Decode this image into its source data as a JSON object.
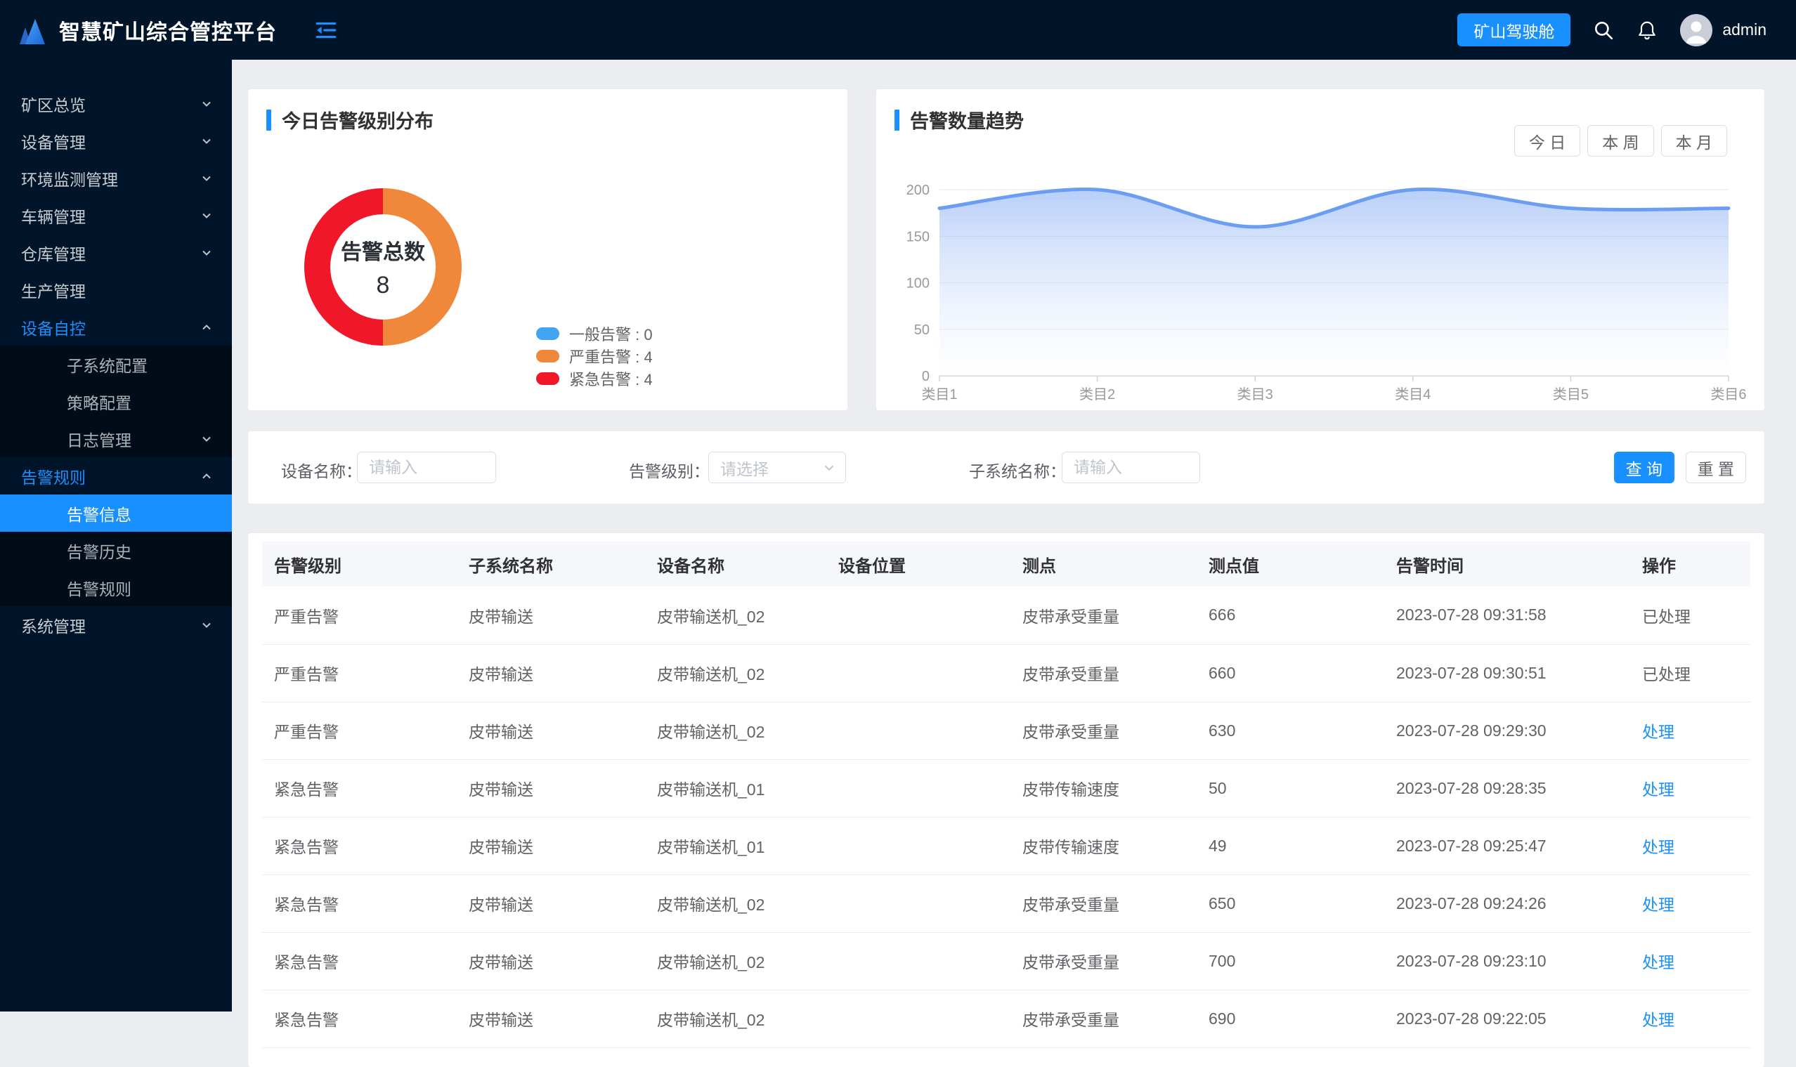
{
  "header": {
    "app_title": "智慧矿山综合管控平台",
    "cockpit_button": "矿山驾驶舱",
    "username": "admin"
  },
  "sidebar": {
    "items": [
      {
        "key": "mine-overview",
        "label": "矿区总览",
        "arrow": "down"
      },
      {
        "key": "device-management",
        "label": "设备管理",
        "arrow": "down"
      },
      {
        "key": "env-monitor-management",
        "label": "环境监测管理",
        "arrow": "down"
      },
      {
        "key": "vehicle-management",
        "label": "车辆管理",
        "arrow": "down"
      },
      {
        "key": "warehouse-management",
        "label": "仓库管理",
        "arrow": "down"
      },
      {
        "key": "production-management",
        "label": "生产管理",
        "arrow": "none"
      },
      {
        "key": "device-autocontrol",
        "label": "设备自控",
        "arrow": "up",
        "expanded": true,
        "children": [
          {
            "key": "subsystem-config",
            "label": "子系统配置",
            "arrow": "none"
          },
          {
            "key": "strategy-config",
            "label": "策略配置",
            "arrow": "none"
          },
          {
            "key": "log-management",
            "label": "日志管理",
            "arrow": "down"
          }
        ]
      },
      {
        "key": "alarm-rules-group",
        "label": "告警规则",
        "arrow": "up",
        "expanded": true,
        "children": [
          {
            "key": "alarm-info",
            "label": "告警信息",
            "arrow": "none",
            "active": true
          },
          {
            "key": "alarm-history",
            "label": "告警历史",
            "arrow": "none"
          },
          {
            "key": "alarm-rules",
            "label": "告警规则",
            "arrow": "none"
          }
        ]
      },
      {
        "key": "system-management",
        "label": "系统管理",
        "arrow": "down"
      }
    ]
  },
  "cards": {
    "distribution_title": "今日告警级别分布",
    "trend_title": "告警数量趋势",
    "range_buttons": [
      "今 日",
      "本 周",
      "本 月"
    ]
  },
  "chart_data": [
    {
      "type": "pie",
      "title": "今日告警级别分布",
      "donut": true,
      "labels": [
        "一般告警",
        "严重告警",
        "紧急告警"
      ],
      "values": [
        0,
        4,
        4
      ],
      "colors": [
        "#41a4f1",
        "#f0883c",
        "#f01828"
      ],
      "center_label": "告警总数",
      "center_value": "8",
      "legend_position": "right"
    },
    {
      "type": "line",
      "title": "告警数量趋势",
      "categories": [
        "类目1",
        "类目2",
        "类目3",
        "类目4",
        "类目5",
        "类目6"
      ],
      "values": [
        180,
        200,
        160,
        200,
        180,
        180
      ],
      "ylim": [
        0,
        200
      ],
      "yticks": [
        0,
        50,
        100,
        150,
        200
      ],
      "line_color": "#6b9ef2",
      "area_gradient_top": "#7fa8f3",
      "area_gradient_bottom": "#ffffff",
      "smooth": true,
      "grid": true,
      "legend_position": "none"
    }
  ],
  "filters": {
    "device_name_label": "设备名称：",
    "device_name_placeholder": "请输入",
    "alarm_level_label": "告警级别：",
    "alarm_level_placeholder": "请选择",
    "subsystem_label": "子系统名称：",
    "subsystem_placeholder": "请输入",
    "search_button": "查 询",
    "reset_button": "重 置"
  },
  "table": {
    "columns": [
      "告警级别",
      "子系统名称",
      "设备名称",
      "设备位置",
      "测点",
      "测点值",
      "告警时间",
      "操作"
    ],
    "rows": [
      {
        "level": "严重告警",
        "subsystem": "皮带输送",
        "device": "皮带输送机_02",
        "location": "",
        "point": "皮带承受重量",
        "value": "666",
        "time": "2023-07-28 09:31:58",
        "action": "已处理",
        "action_type": "done"
      },
      {
        "level": "严重告警",
        "subsystem": "皮带输送",
        "device": "皮带输送机_02",
        "location": "",
        "point": "皮带承受重量",
        "value": "660",
        "time": "2023-07-28 09:30:51",
        "action": "已处理",
        "action_type": "done"
      },
      {
        "level": "严重告警",
        "subsystem": "皮带输送",
        "device": "皮带输送机_02",
        "location": "",
        "point": "皮带承受重量",
        "value": "630",
        "time": "2023-07-28 09:29:30",
        "action": "处理",
        "action_type": "link"
      },
      {
        "level": "紧急告警",
        "subsystem": "皮带输送",
        "device": "皮带输送机_01",
        "location": "",
        "point": "皮带传输速度",
        "value": "50",
        "time": "2023-07-28 09:28:35",
        "action": "处理",
        "action_type": "link"
      },
      {
        "level": "紧急告警",
        "subsystem": "皮带输送",
        "device": "皮带输送机_01",
        "location": "",
        "point": "皮带传输速度",
        "value": "49",
        "time": "2023-07-28 09:25:47",
        "action": "处理",
        "action_type": "link"
      },
      {
        "level": "紧急告警",
        "subsystem": "皮带输送",
        "device": "皮带输送机_02",
        "location": "",
        "point": "皮带承受重量",
        "value": "650",
        "time": "2023-07-28 09:24:26",
        "action": "处理",
        "action_type": "link"
      },
      {
        "level": "紧急告警",
        "subsystem": "皮带输送",
        "device": "皮带输送机_02",
        "location": "",
        "point": "皮带承受重量",
        "value": "700",
        "time": "2023-07-28 09:23:10",
        "action": "处理",
        "action_type": "link"
      },
      {
        "level": "紧急告警",
        "subsystem": "皮带输送",
        "device": "皮带输送机_02",
        "location": "",
        "point": "皮带承受重量",
        "value": "690",
        "time": "2023-07-28 09:22:05",
        "action": "处理",
        "action_type": "link"
      }
    ]
  },
  "colors": {
    "accent": "#1890ff",
    "general_alarm": "#41a4f1",
    "severe_alarm": "#f0883c",
    "emergency_alarm": "#f01828",
    "sidebar_bg": "#001529",
    "submenu_bg": "#000c17",
    "main_bg": "#ebedf0"
  }
}
